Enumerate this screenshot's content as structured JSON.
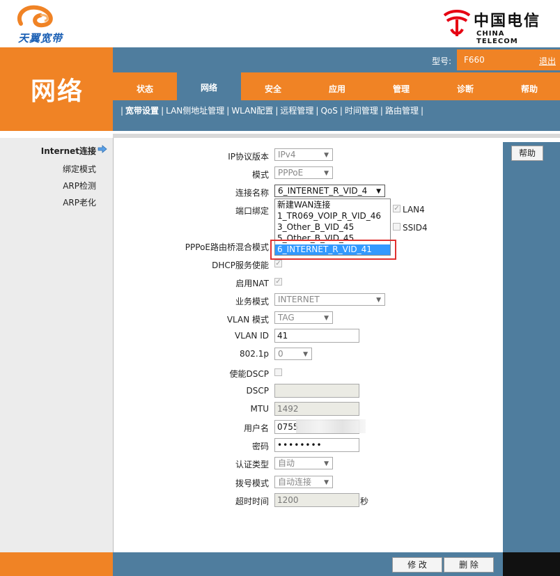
{
  "header": {
    "brand_text": "天翼宽带",
    "telecom_cn": "中国电信",
    "telecom_en": "CHINA TELECOM"
  },
  "left_panel": {
    "title": "网络"
  },
  "topbar": {
    "model_label": "型号:",
    "model_value": "F660",
    "logout": "退出"
  },
  "tabs": [
    {
      "label": "状态"
    },
    {
      "label": "网络"
    },
    {
      "label": "安全"
    },
    {
      "label": "应用"
    },
    {
      "label": "管理"
    },
    {
      "label": "诊断"
    },
    {
      "label": "帮助"
    }
  ],
  "active_tab": "网络",
  "subnav": [
    {
      "label": "宽带设置"
    },
    {
      "label": "LAN侧地址管理"
    },
    {
      "label": "WLAN配置"
    },
    {
      "label": "远程管理"
    },
    {
      "label": "QoS"
    },
    {
      "label": "时间管理"
    },
    {
      "label": "路由管理"
    }
  ],
  "leftmenu": [
    {
      "label": "Internet连接"
    },
    {
      "label": "绑定模式"
    },
    {
      "label": "ARP检测"
    },
    {
      "label": "ARP老化"
    }
  ],
  "help_button": "帮助",
  "form": {
    "ip_version": {
      "label": "IP协议版本",
      "value": "IPv4"
    },
    "mode": {
      "label": "模式",
      "value": "PPPoE"
    },
    "conn_name": {
      "label": "连接名称",
      "value": "6_INTERNET_R_VID_4"
    },
    "port_bind": {
      "label": "端口绑定",
      "lan4": "LAN4",
      "ssid4": "SSID4"
    },
    "pppoe_bridge": {
      "label": "PPPoE路由桥混合模式"
    },
    "dhcp": {
      "label": "DHCP服务使能"
    },
    "nat": {
      "label": "启用NAT"
    },
    "service_mode": {
      "label": "业务模式",
      "value": "INTERNET"
    },
    "vlan_mode": {
      "label": "VLAN 模式",
      "value": "TAG"
    },
    "vlan_id": {
      "label": "VLAN ID",
      "value": "41"
    },
    "dot1p": {
      "label": "802.1p",
      "value": "0"
    },
    "dscp_enable": {
      "label": "使能DSCP"
    },
    "dscp": {
      "label": "DSCP",
      "value": ""
    },
    "mtu": {
      "label": "MTU",
      "value": "1492"
    },
    "username": {
      "label": "用户名",
      "value": "0755"
    },
    "password": {
      "label": "密码",
      "value": "••••••••"
    },
    "auth_type": {
      "label": "认证类型",
      "value": "自动"
    },
    "dial_mode": {
      "label": "拨号模式",
      "value": "自动连接"
    },
    "timeout": {
      "label": "超时时间",
      "value": "1200",
      "unit": "秒"
    }
  },
  "dropdown_options": [
    "新建WAN连接",
    "1_TR069_VOIP_R_VID_46",
    "3_Other_B_VID_45",
    "5_Other_B_VID_45",
    "6_INTERNET_R_VID_41"
  ],
  "dropdown_selected": "6_INTERNET_R_VID_41",
  "buttons": {
    "modify": "修 改",
    "delete": "删 除"
  },
  "colors": {
    "orange": "#f08325",
    "blue": "#4f7d9e",
    "highlight": "#3399ff",
    "red_box": "#e0312f"
  }
}
